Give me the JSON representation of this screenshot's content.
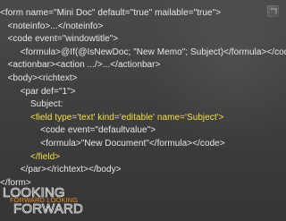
{
  "code_lines": [
    {
      "text": "<form name=\"Mini Doc\" default=\"true\" mailable=\"true\">",
      "highlight": false
    },
    {
      "text": "   <noteinfo>...</noteinfo>",
      "highlight": false
    },
    {
      "text": "   <code event=\"windowtitle\">",
      "highlight": false
    },
    {
      "text": "        <formula>@If(@IsNewDoc; \"New Memo\"; Subject)</formula></code>",
      "highlight": false
    },
    {
      "text": "   <actionbar><action .../>...</actionbar>",
      "highlight": false
    },
    {
      "text": "   <body><richtext>",
      "highlight": false
    },
    {
      "text": "        <par def=\"1\">",
      "highlight": false
    },
    {
      "text": "            Subject:",
      "highlight": false
    },
    {
      "text": "            <field type='text' kind='editable' name='Subject'>",
      "highlight": true
    },
    {
      "text": "                <code event=\"defaultvalue\">",
      "highlight": false
    },
    {
      "text": "                <formula>\"New Document\"</formula></code>",
      "highlight": false
    },
    {
      "text": "            </field>",
      "highlight": true
    },
    {
      "text": "        </par></richtext></body>",
      "highlight": false
    },
    {
      "text": "</form>",
      "highlight": false
    }
  ],
  "logo": {
    "line1": "LOOKING",
    "line2": "FORWARD",
    "overlay": "FORWARD LOOKING"
  },
  "colors": {
    "text": "#e9e9e9",
    "highlight": "#f5e04a",
    "background": "#3f3f3f"
  },
  "icons": {
    "corner": "corner-arrow-icon"
  }
}
